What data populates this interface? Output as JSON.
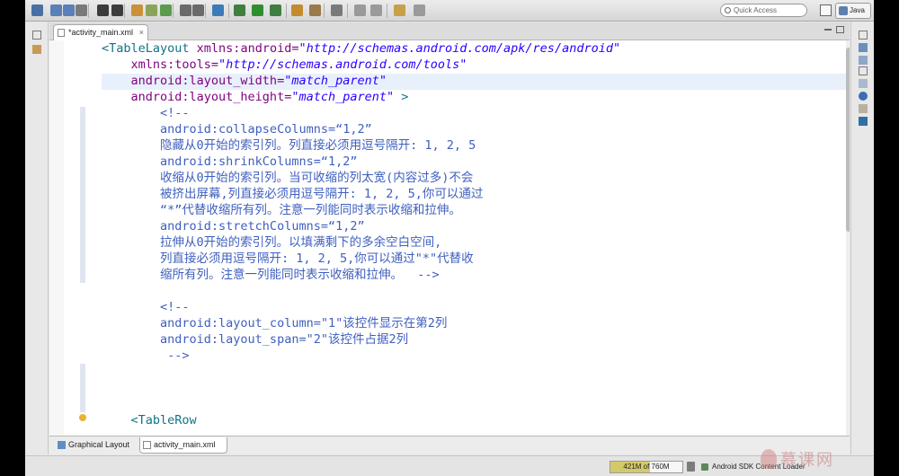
{
  "toolbar": {
    "quick_access_placeholder": "Quick Access",
    "perspective": "Java",
    "icons": [
      "new-icon",
      "save-icon",
      "save-all-icon",
      "print-icon",
      "export-icon",
      "import-icon",
      "open-type-icon",
      "open-task-icon",
      "new-android-icon",
      "sdk-manager-icon",
      "avd-manager-icon",
      "lint-icon",
      "debug-icon",
      "run-icon",
      "run-external-icon",
      "new-class-icon",
      "open-perspective-icon",
      "search-icon",
      "next-annotation-icon",
      "prev-annotation-icon",
      "back-icon",
      "forward-icon"
    ]
  },
  "editor": {
    "tab_label": "*activity_main.xml",
    "lines": [
      {
        "parts": [
          {
            "t": "<TableLayout ",
            "c": "tag"
          },
          {
            "t": "xmlns:android=",
            "c": "attr"
          },
          {
            "t": "\"http://schemas.android.com/apk/res/android\"",
            "c": "val"
          }
        ]
      },
      {
        "parts": [
          {
            "t": "    xmlns:tools=",
            "c": "attr"
          },
          {
            "t": "\"http://schemas.android.com/tools\"",
            "c": "val"
          }
        ]
      },
      {
        "parts": [
          {
            "t": "    android:layout_width=",
            "c": "attr"
          },
          {
            "t": "\"match_parent\"",
            "c": "val"
          }
        ]
      },
      {
        "parts": [
          {
            "t": "    android:layout_height=",
            "c": "attr"
          },
          {
            "t": "\"match_parent\"",
            "c": "val"
          },
          {
            "t": " >",
            "c": "tag"
          }
        ]
      },
      {
        "parts": [
          {
            "t": "        <!--",
            "c": "cmt"
          }
        ]
      },
      {
        "parts": [
          {
            "t": "        android:collapseColumns=“1,2”",
            "c": "cmt"
          }
        ]
      },
      {
        "parts": [
          {
            "t": "        隐藏从0开始的索引列。列直接必须用逗号隔开: 1, 2, 5",
            "c": "cmt"
          }
        ]
      },
      {
        "parts": [
          {
            "t": "        android:shrinkColumns=“1,2”",
            "c": "cmt"
          }
        ]
      },
      {
        "parts": [
          {
            "t": "        收缩从0开始的索引列。当可收缩的列太宽(内容过多)不会",
            "c": "cmt"
          }
        ]
      },
      {
        "parts": [
          {
            "t": "        被挤出屏幕,列直接必须用逗号隔开: 1, 2, 5,你可以通过",
            "c": "cmt"
          }
        ]
      },
      {
        "parts": [
          {
            "t": "        “*”代替收缩所有列。注意一列能同时表示收缩和拉伸。",
            "c": "cmt"
          }
        ]
      },
      {
        "parts": [
          {
            "t": "        android:stretchColumns=“1,2”",
            "c": "cmt"
          }
        ]
      },
      {
        "parts": [
          {
            "t": "        拉伸从0开始的索引列。以填满剩下的多余空白空间,",
            "c": "cmt"
          }
        ]
      },
      {
        "parts": [
          {
            "t": "        列直接必须用逗号隔开: 1, 2, 5,你可以通过\"*\"代替收",
            "c": "cmt"
          }
        ]
      },
      {
        "parts": [
          {
            "t": "        缩所有列。注意一列能同时表示收缩和拉伸。  -->",
            "c": "cmt"
          }
        ]
      },
      {
        "parts": [
          {
            "t": "",
            "c": "cmt"
          }
        ]
      },
      {
        "parts": [
          {
            "t": "        <!--",
            "c": "cmt"
          }
        ]
      },
      {
        "parts": [
          {
            "t": "        android:layout_column=\"1\"该控件显示在第2列",
            "c": "cmt"
          }
        ]
      },
      {
        "parts": [
          {
            "t": "        android:layout_span=\"2\"该控件占据2列",
            "c": "cmt"
          }
        ]
      },
      {
        "parts": [
          {
            "t": "         -->",
            "c": "cmt"
          }
        ]
      },
      {
        "parts": [
          {
            "t": "",
            "c": "cmt"
          }
        ]
      },
      {
        "parts": [
          {
            "t": "",
            "c": "cmt"
          }
        ]
      },
      {
        "parts": [
          {
            "t": "",
            "c": "cmt"
          }
        ]
      },
      {
        "parts": [
          {
            "t": "    <TableRow",
            "c": "tag"
          }
        ]
      }
    ]
  },
  "bottom_tabs": {
    "graphical": "Graphical Layout",
    "xml": "activity_main.xml"
  },
  "status": {
    "heap": "421M of 760M",
    "heap_used_fraction": 0.55,
    "loader": "Android SDK Content Loader"
  },
  "watermark": "慕课网"
}
